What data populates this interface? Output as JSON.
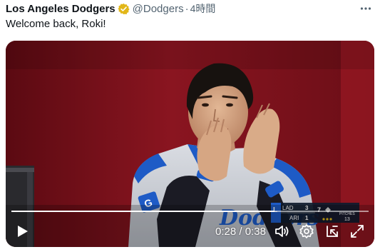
{
  "tweet": {
    "author_name": "Los Angeles Dodgers",
    "handle": "@Dodgers",
    "separator": "·",
    "time": "4時間",
    "text": "Welcome back, Roki!"
  },
  "icons": {
    "verified": "verified-badge-icon",
    "more": "more-options-icon",
    "play": "play-icon",
    "volume": "volume-icon",
    "settings": "gear-icon",
    "pip": "picture-in-picture-icon",
    "fullscreen": "fullscreen-icon"
  },
  "video": {
    "current_time": "0:28",
    "duration": "0:38",
    "time_separator": " / ",
    "progress": 0.737,
    "jersey_text": "Dodgers",
    "scorebug": {
      "away_team": "LAD",
      "away_score": "3",
      "home_team": "ARI",
      "home_score": "1",
      "inning": "7",
      "pitches_label": "PITCHES",
      "pitches_value": "13"
    }
  },
  "colors": {
    "verified_gold": "#e2b719",
    "text_primary": "#0f1419",
    "text_secondary": "#536471",
    "dodger_blue": "#1e5bc6",
    "backdrop_red": "#7a0f1a"
  }
}
